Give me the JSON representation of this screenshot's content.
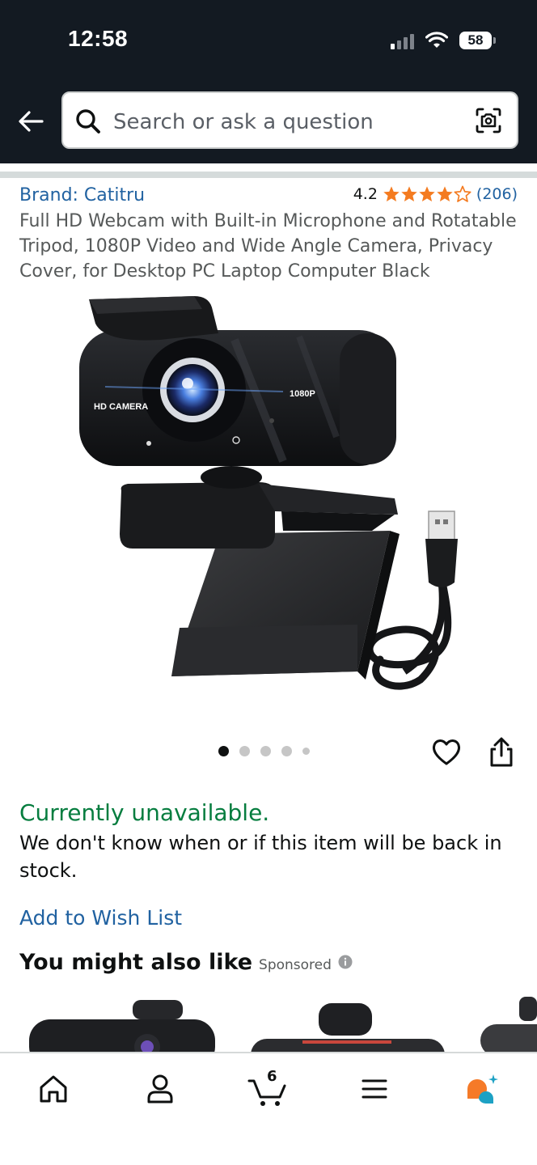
{
  "status_bar": {
    "time": "12:58",
    "battery": "58"
  },
  "search": {
    "placeholder": "Search or ask a question"
  },
  "product": {
    "brand": "Brand: Catitru",
    "rating": "4.2",
    "stars": 4.2,
    "review_count": "(206)",
    "title": "Full HD Webcam with Built-in Microphone and Rotatable Tripod, 1080P Video and Wide Angle Camera, Privacy Cover, for Desktop PC Laptop Computer Black",
    "image_text": {
      "left_label": "HD CAMERA",
      "right_label": "1080P"
    },
    "image_count": 5,
    "active_image": 1
  },
  "availability": {
    "status": "Currently unavailable.",
    "message": "We don't know when or if this item will be back in stock."
  },
  "actions": {
    "wishlist": "Add to Wish List"
  },
  "recommendations": {
    "title": "You might also like",
    "sponsored": "Sponsored"
  },
  "nav": {
    "items": [
      "home-icon",
      "account-icon",
      "cart-icon",
      "menu-icon",
      "rufus-icon"
    ],
    "cart_count": "6"
  },
  "colors": {
    "header_bg": "#131a22",
    "link": "#2162a1",
    "star": "#f47b20",
    "available_green": "#067d3f"
  }
}
